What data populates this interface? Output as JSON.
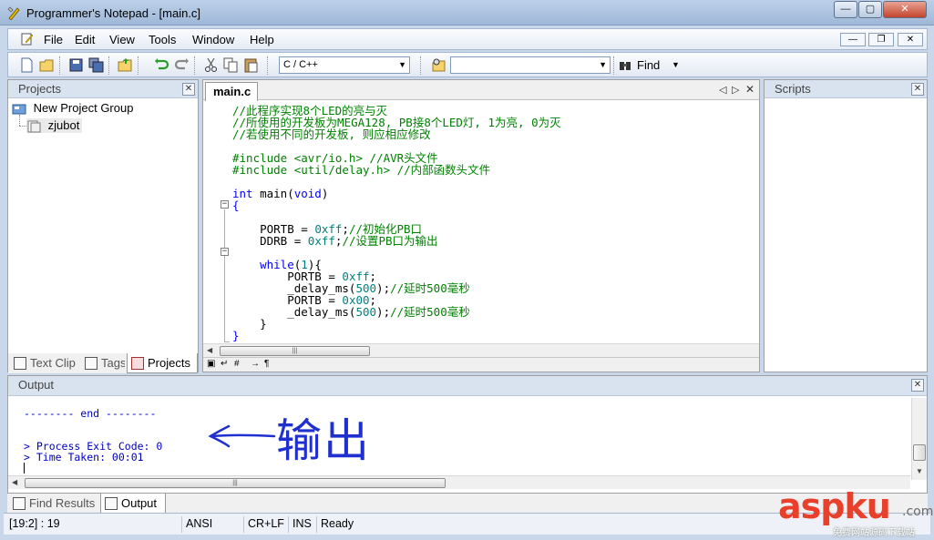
{
  "window": {
    "title": "Programmer's Notepad - [main.c]",
    "controls": {
      "minimize": "—",
      "maximize": "▢",
      "close": "✕"
    }
  },
  "menu": {
    "items": [
      "File",
      "Edit",
      "View",
      "Tools",
      "Window",
      "Help"
    ],
    "mdi_controls": {
      "minimize": "—",
      "restore": "❐",
      "close": "✕"
    }
  },
  "toolbar": {
    "scheme_select": "C / C++",
    "search_value": "",
    "find_label": "Find"
  },
  "projects_panel": {
    "title": "Projects",
    "tree": [
      {
        "label": "New Project Group",
        "icon": "project-group-icon"
      },
      {
        "label": "zjubot",
        "icon": "project-icon",
        "selected": true
      }
    ],
    "tabs": [
      {
        "label": "Text Clips",
        "icon": "text-clips-icon"
      },
      {
        "label": "Tags",
        "icon": "tags-icon"
      },
      {
        "label": "Projects",
        "icon": "projects-icon",
        "active": true
      }
    ]
  },
  "editor": {
    "tab_label": "main.c",
    "tab_nav": {
      "prev": "◁",
      "next": "▷",
      "close": "✕"
    },
    "lines": [
      {
        "text": "//此程序实现8个LED的亮与灭",
        "kind": "comment"
      },
      {
        "text": "//所使用的开发板为MEGA128, PB接8个LED灯, 1为亮, 0为灭",
        "kind": "comment"
      },
      {
        "text": "//若使用不同的开发板, 则应相应修改",
        "kind": "comment"
      },
      {
        "text": "",
        "kind": "plain"
      },
      {
        "text": "#include <avr/io.h> //AVR头文件",
        "kind": "comment"
      },
      {
        "text": "#include <util/delay.h> //内部函数头文件",
        "kind": "comment"
      },
      {
        "text": "",
        "kind": "plain"
      },
      {
        "pre": "",
        "kw": "int",
        "post": " main(",
        "kw2": "void",
        "post2": ")",
        "kind": "mixed"
      },
      {
        "text": "{",
        "kind": "kw-plain"
      },
      {
        "text": "",
        "kind": "plain"
      },
      {
        "pre": "    PORTB = ",
        "num": "0xff",
        "post": ";",
        "cm": "//初始化PB口",
        "kind": "assign"
      },
      {
        "pre": "    DDRB = ",
        "num": "0xff",
        "post": ";",
        "cm": "//设置PB口为输出",
        "kind": "assign"
      },
      {
        "text": "",
        "kind": "plain"
      },
      {
        "pre": "    ",
        "kw": "while",
        "post": "(",
        "num": "1",
        "post2": "){",
        "kind": "while"
      },
      {
        "pre": "        PORTB = ",
        "num": "0xff",
        "post": ";",
        "cm": "",
        "kind": "assign"
      },
      {
        "pre": "        _delay_ms(",
        "num": "500",
        "post": ");",
        "cm": "//延时500毫秒",
        "kind": "assign"
      },
      {
        "pre": "        PORTB = ",
        "num": "0x00",
        "post": ";",
        "cm": "",
        "kind": "assign"
      },
      {
        "pre": "        _delay_ms(",
        "num": "500",
        "post": ");",
        "cm": "//延时500毫秒",
        "kind": "assign"
      },
      {
        "text": "    }",
        "kind": "plain"
      },
      {
        "text": "}",
        "kind": "kw-plain"
      }
    ],
    "hscroll_thumb": "|||"
  },
  "scripts_panel": {
    "title": "Scripts"
  },
  "output_panel": {
    "title": "Output",
    "lines": [
      "-------- end --------",
      "",
      "",
      "> Process Exit Code: 0",
      "> Time Taken: 00:01"
    ],
    "annotation": "输出",
    "tabs": [
      {
        "label": "Find Results",
        "icon": "find-results-icon"
      },
      {
        "label": "Output",
        "icon": "output-icon",
        "active": true
      }
    ]
  },
  "statusbar": {
    "position": "[19:2] : 19",
    "encoding": "ANSI",
    "line_ending": "CR+LF",
    "insert_mode": "INS",
    "status": "Ready"
  },
  "watermark": {
    "brand": "aspku",
    "domain": ".com",
    "tagline": "免费网站源码下载站"
  },
  "colors": {
    "accent": "#0000ff",
    "comment": "#008000",
    "number": "#008080",
    "output": "#0000c0",
    "annotation": "#1f2fd0",
    "watermark": "#e8402b"
  }
}
